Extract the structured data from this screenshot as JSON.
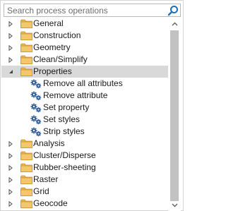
{
  "search": {
    "placeholder": "Search process operations"
  },
  "tree": {
    "items": [
      {
        "label": "General",
        "type": "folder",
        "expanded": false
      },
      {
        "label": "Construction",
        "type": "folder",
        "expanded": false
      },
      {
        "label": "Geometry",
        "type": "folder",
        "expanded": false
      },
      {
        "label": "Clean/Simplify",
        "type": "folder",
        "expanded": false
      },
      {
        "label": "Properties",
        "type": "folder",
        "expanded": true,
        "selected": true
      },
      {
        "label": "Remove all attributes",
        "type": "operation"
      },
      {
        "label": "Remove attribute",
        "type": "operation"
      },
      {
        "label": "Set property",
        "type": "operation"
      },
      {
        "label": "Set styles",
        "type": "operation"
      },
      {
        "label": "Strip styles",
        "type": "operation"
      },
      {
        "label": "Analysis",
        "type": "folder",
        "expanded": false
      },
      {
        "label": "Cluster/Disperse",
        "type": "folder",
        "expanded": false
      },
      {
        "label": "Rubber-sheeting",
        "type": "folder",
        "expanded": false
      },
      {
        "label": "Raster",
        "type": "folder",
        "expanded": false
      },
      {
        "label": "Grid",
        "type": "folder",
        "expanded": false
      },
      {
        "label": "Geocode",
        "type": "folder",
        "expanded": false
      }
    ]
  },
  "icons": {
    "search": "magnifier-icon",
    "folder": "folder-icon",
    "operation": "gear-icon",
    "collapsed": "triangle-right-icon",
    "expanded": "triangle-down-icon"
  },
  "colors": {
    "folder_fill": "#f3c86a",
    "folder_tab": "#e8b44c",
    "gear": "#2f5d9a",
    "selection": "#d9d9d9",
    "search_icon": "#1f6fb2"
  }
}
